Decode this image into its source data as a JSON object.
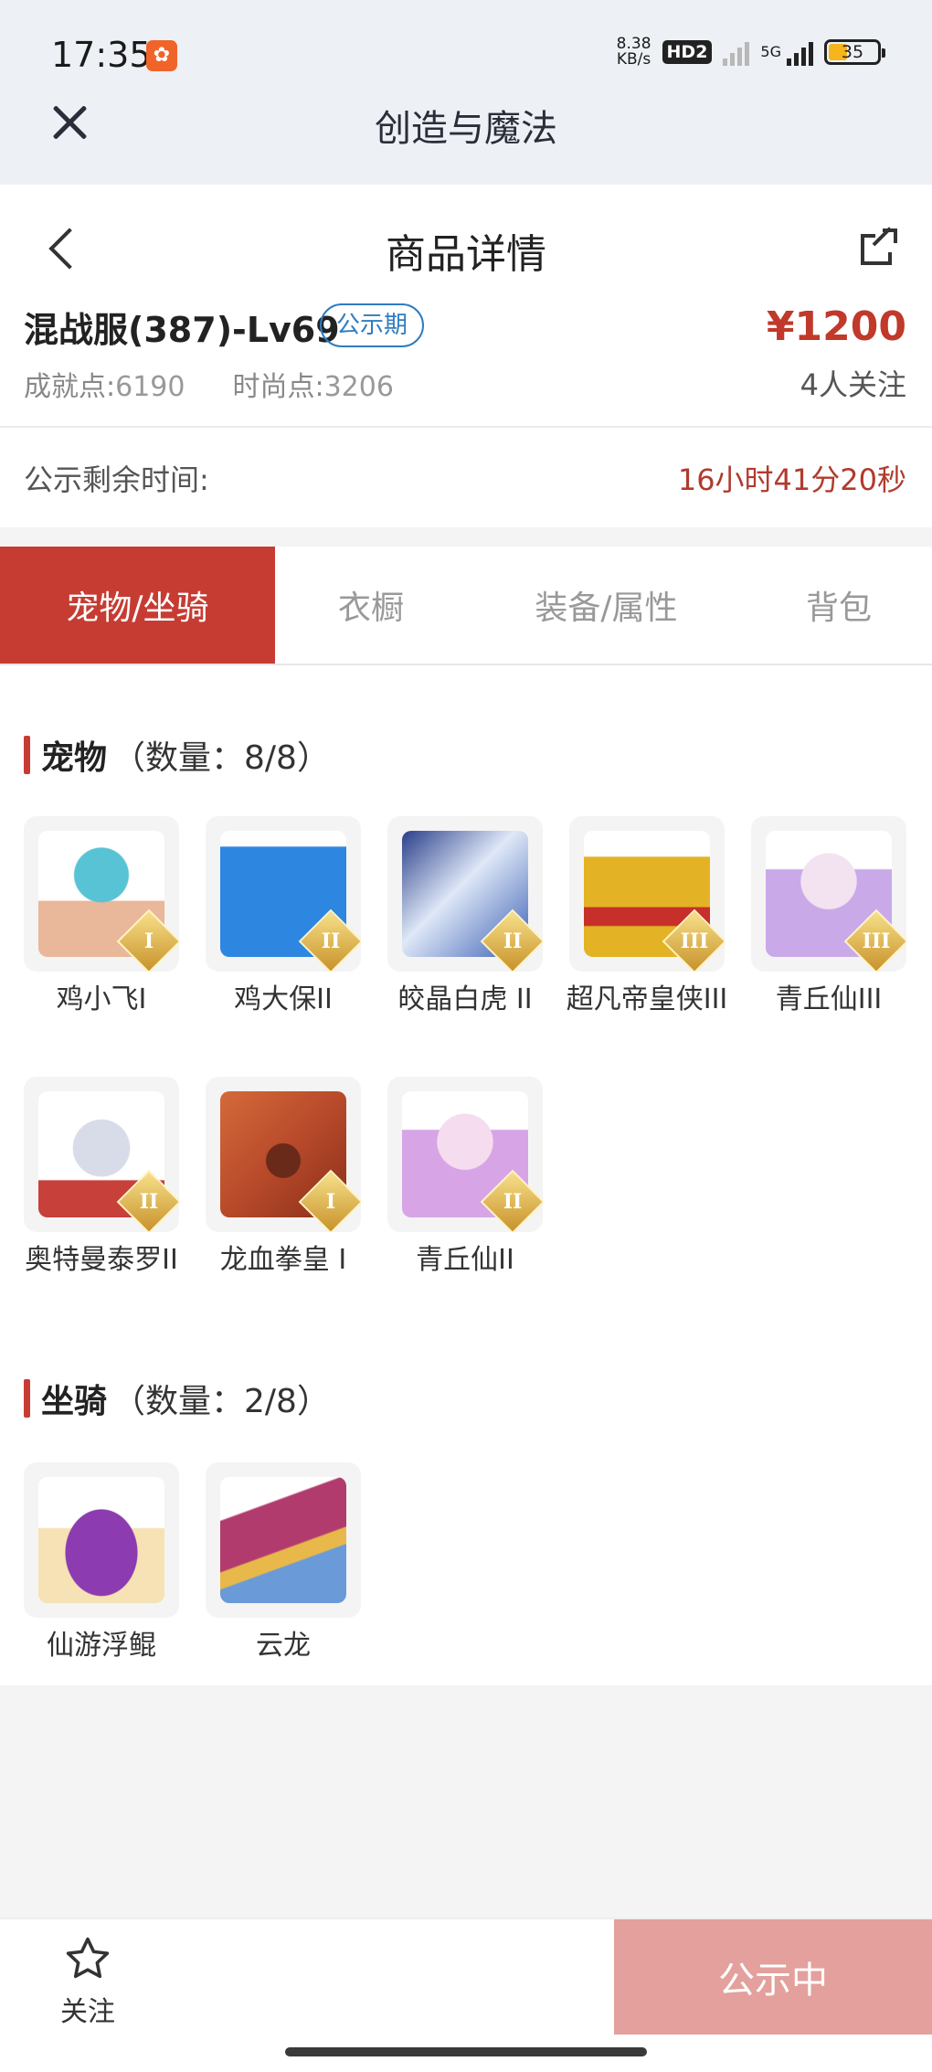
{
  "status_bar": {
    "time": "17:35",
    "net_speed_value": "8.38",
    "net_speed_unit": "KB/s",
    "hd_label": "HD2",
    "network_label": "5G",
    "battery_level": "35",
    "app_icon": "app-notification-icon"
  },
  "app_bar": {
    "title": "创造与魔法",
    "close_icon": "close-icon"
  },
  "product": {
    "page_title": "商品详情",
    "server_name": "混战服(387)-Lv69",
    "tag": "公示期",
    "price": "¥1200",
    "achievement_label": "成就点:",
    "achievement_value": "6190",
    "fashion_label": "时尚点:",
    "fashion_value": "3206",
    "followers": "4人关注",
    "remaining_label": "公示剩余时间:",
    "remaining_value": "16小时41分20秒"
  },
  "tabs": [
    {
      "label": "宠物/坐骑",
      "active": true
    },
    {
      "label": "衣橱",
      "active": false
    },
    {
      "label": "装备/属性",
      "active": false
    },
    {
      "label": "背包",
      "active": false
    }
  ],
  "pets": {
    "title": "宠物",
    "count": "（数量：8/8）",
    "items": [
      {
        "name": "鸡小飞I",
        "badge": "I",
        "color": "#58c3d4"
      },
      {
        "name": "鸡大保II",
        "badge": "II",
        "color": "#2d86e0"
      },
      {
        "name": "皎晶白虎 II",
        "badge": "II",
        "color": "#3a5fb4"
      },
      {
        "name": "超凡帝皇侠III",
        "badge": "III",
        "color": "#e3b325"
      },
      {
        "name": "青丘仙III",
        "badge": "III",
        "color": "#c9a9e8"
      },
      {
        "name": "奥特曼泰罗II",
        "badge": "II",
        "color": "#c7403a"
      },
      {
        "name": "龙血拳皇 I",
        "badge": "I",
        "color": "#b84a2a"
      },
      {
        "name": "青丘仙II",
        "badge": "II",
        "color": "#d7a4e6"
      }
    ]
  },
  "mounts": {
    "title": "坐骑",
    "count": "（数量：2/8）",
    "items": [
      {
        "name": "仙游浮鲲",
        "color": "#8c3bb0"
      },
      {
        "name": "云龙",
        "color": "#b23b6e"
      }
    ]
  },
  "bottom_bar": {
    "follow_label": "关注",
    "follow_icon": "star-icon",
    "status_button": "公示中"
  },
  "colors": {
    "accent": "#c63c33",
    "price": "#c0392b",
    "tag_blue": "#2f7cc0",
    "disabled_button": "#e3a09c"
  }
}
